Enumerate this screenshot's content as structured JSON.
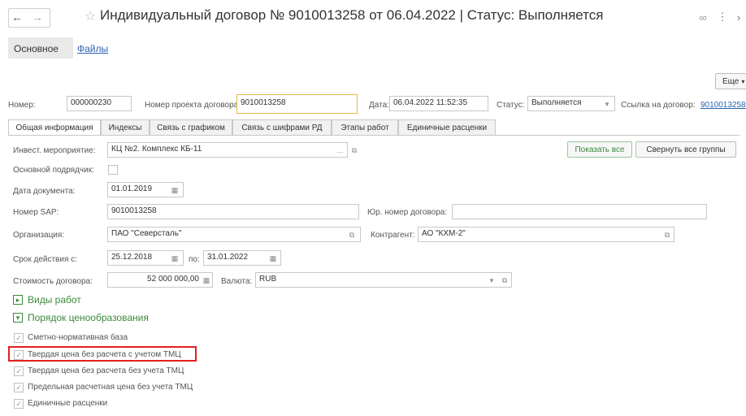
{
  "header": {
    "title": "Индивидуальный договор № 9010013258 от 06.04.2022 | Статус: Выполняется",
    "back_icon": "arrow-left-icon",
    "forward_icon": "arrow-right-icon",
    "star_icon": "star-icon",
    "link_icon": "link-icon",
    "more_icon": "more-icon",
    "close_icon": "chevron-right-icon"
  },
  "cmdbar": {
    "main_tab": "Основное",
    "files_tab": "Файлы",
    "more_button": "Еще"
  },
  "top_fields": {
    "number_label": "Номер:",
    "number_value": "000000230",
    "project_label": "Номер проекта договора:",
    "project_value": "9010013258",
    "date_label": "Дата:",
    "date_value": "06.04.2022 11:52:35",
    "status_label": "Статус:",
    "status_value": "Выполняется",
    "ref_label": "Ссылка на договор:",
    "ref_value": "9010013258"
  },
  "tabs": [
    {
      "label": "Общая информация"
    },
    {
      "label": "Индексы"
    },
    {
      "label": "Связь с графиком"
    },
    {
      "label": "Связь с шифрами РД"
    },
    {
      "label": "Этапы работ"
    },
    {
      "label": "Единичные расценки"
    }
  ],
  "form": {
    "invest_label": "Инвест. мероприятие:",
    "invest_value": "КЦ №2. Комплекс КБ-11",
    "show_all": "Показать все",
    "collapse_all": "Свернуть все группы",
    "contractor_label": "Основной подрядчик:",
    "doc_date_label": "Дата документа:",
    "doc_date_value": "01.01.2019",
    "sap_label": "Номер SAP:",
    "sap_value": "9010013258",
    "legal_num_label": "Юр. номер договора:",
    "legal_num_value": "",
    "org_label": "Организация:",
    "org_value": "ПАО \"Северсталь\"",
    "counterparty_label": "Контрагент:",
    "counterparty_value": "АО \"КХМ-2\"",
    "period_label": "Срок действия с:",
    "period_from": "25.12.2018",
    "period_to_label": "по:",
    "period_to": "31.01.2022",
    "cost_label": "Стоимость договора:",
    "cost_value": "52 000 000,00",
    "currency_label": "Валюта:",
    "currency_value": "RUB"
  },
  "groups": [
    {
      "label": "Виды работ",
      "icon": "expand-icon"
    },
    {
      "label": "Порядок ценообразования",
      "icon": "collapse-icon"
    }
  ],
  "pricing": [
    {
      "label": "Сметно-нормативная база",
      "checked": true
    },
    {
      "label": "Твердая цена без расчета с учетом ТМЦ",
      "checked": true
    },
    {
      "label": "Твердая цена без расчета без учета ТМЦ",
      "checked": true
    },
    {
      "label": "Предельная расчетная цена без учета ТМЦ",
      "checked": true
    },
    {
      "label": "Единичные расценки",
      "checked": true
    }
  ],
  "colors": {
    "accent_green": "#3a8a3a",
    "link_blue": "#2a64b0",
    "highlight_red": "#e02020",
    "focus_yellow": "#e8b84a"
  }
}
